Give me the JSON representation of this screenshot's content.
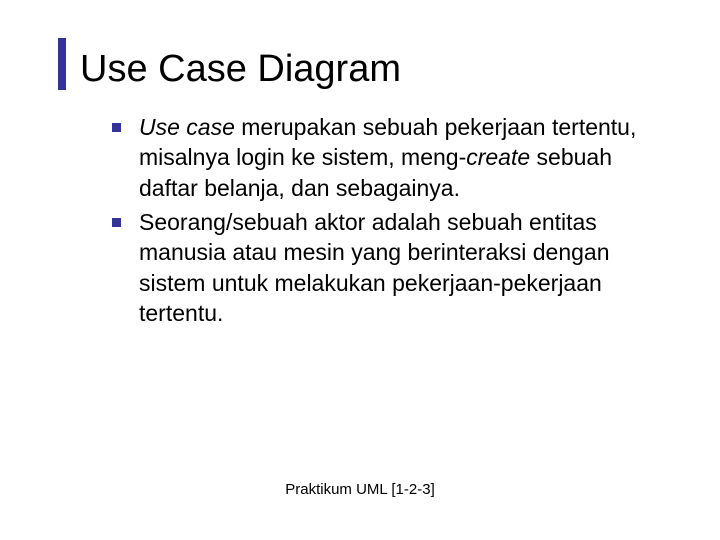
{
  "title": "Use Case Diagram",
  "bullets": [
    {
      "t1": "Use case",
      "t2": " merupakan sebuah pekerjaan tertentu, misalnya login ke sistem, meng-",
      "t3": "create",
      "t4": " sebuah daftar belanja, dan sebagainya."
    },
    {
      "t1": "",
      "t2": "Seorang/sebuah aktor adalah sebuah entitas manusia atau mesin yang berinteraksi dengan sistem untuk melakukan pekerjaan-pekerjaan tertentu.",
      "t3": "",
      "t4": ""
    }
  ],
  "footer": "Praktikum UML [1-2-3]"
}
